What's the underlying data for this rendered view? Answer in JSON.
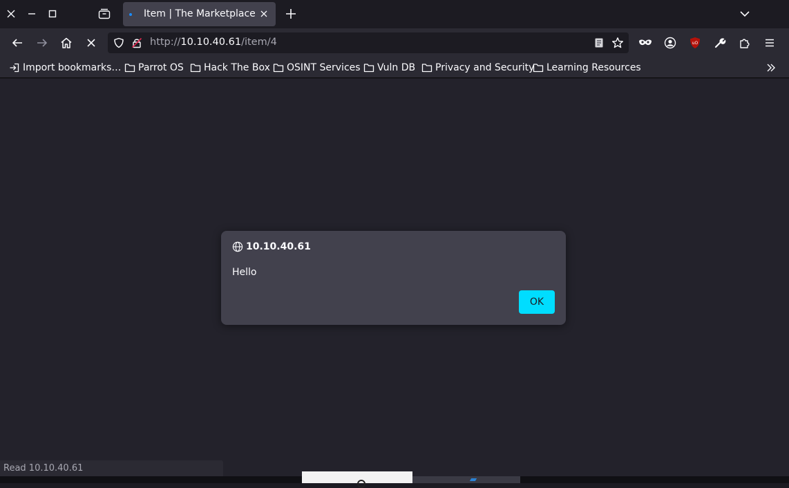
{
  "browser": {
    "tab": {
      "title": "Item | The Marketplace"
    },
    "url": {
      "prefix": "http://",
      "host": "10.10.40.61",
      "path": "/item/4"
    },
    "bookmarks": [
      {
        "label": "Import bookmarks…",
        "icon": "import-icon"
      },
      {
        "label": "Parrot OS",
        "icon": "folder-icon"
      },
      {
        "label": "Hack The Box",
        "icon": "folder-icon"
      },
      {
        "label": "OSINT Services",
        "icon": "folder-icon"
      },
      {
        "label": "Vuln DB",
        "icon": "folder-icon"
      },
      {
        "label": "Privacy and Security",
        "icon": "folder-icon"
      },
      {
        "label": "Learning Resources",
        "icon": "folder-icon"
      }
    ],
    "status_text": "Read 10.10.40.61"
  },
  "dialog": {
    "origin": "10.10.40.61",
    "message": "Hello",
    "ok_label": "OK",
    "ok_color": "#00ddff"
  },
  "theme": {
    "accent": "#00ddff",
    "tab_indicator": "#1a8cff",
    "ublock_badge": "#b5120a"
  }
}
